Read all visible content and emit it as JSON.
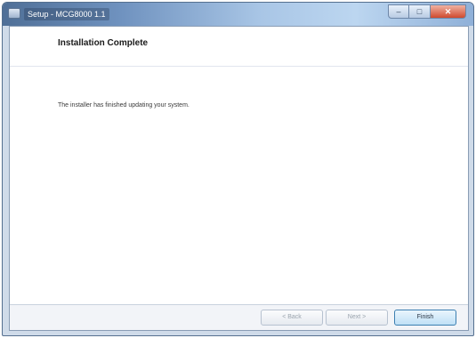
{
  "window": {
    "title": "Setup - MCG8000 1.1",
    "minimize_label": "–",
    "maximize_label": "□",
    "close_label": "✕",
    "icon": "app-installer-icon"
  },
  "page": {
    "title": "Installation Complete",
    "message": "The installer has finished updating your system."
  },
  "buttons": {
    "back": "< Back",
    "next": "Next >",
    "finish": "Finish"
  },
  "colors": {
    "titlebar_accent": "#6f92bf",
    "close_button": "#cf4a2e",
    "finish_border": "#3c7fb1"
  }
}
